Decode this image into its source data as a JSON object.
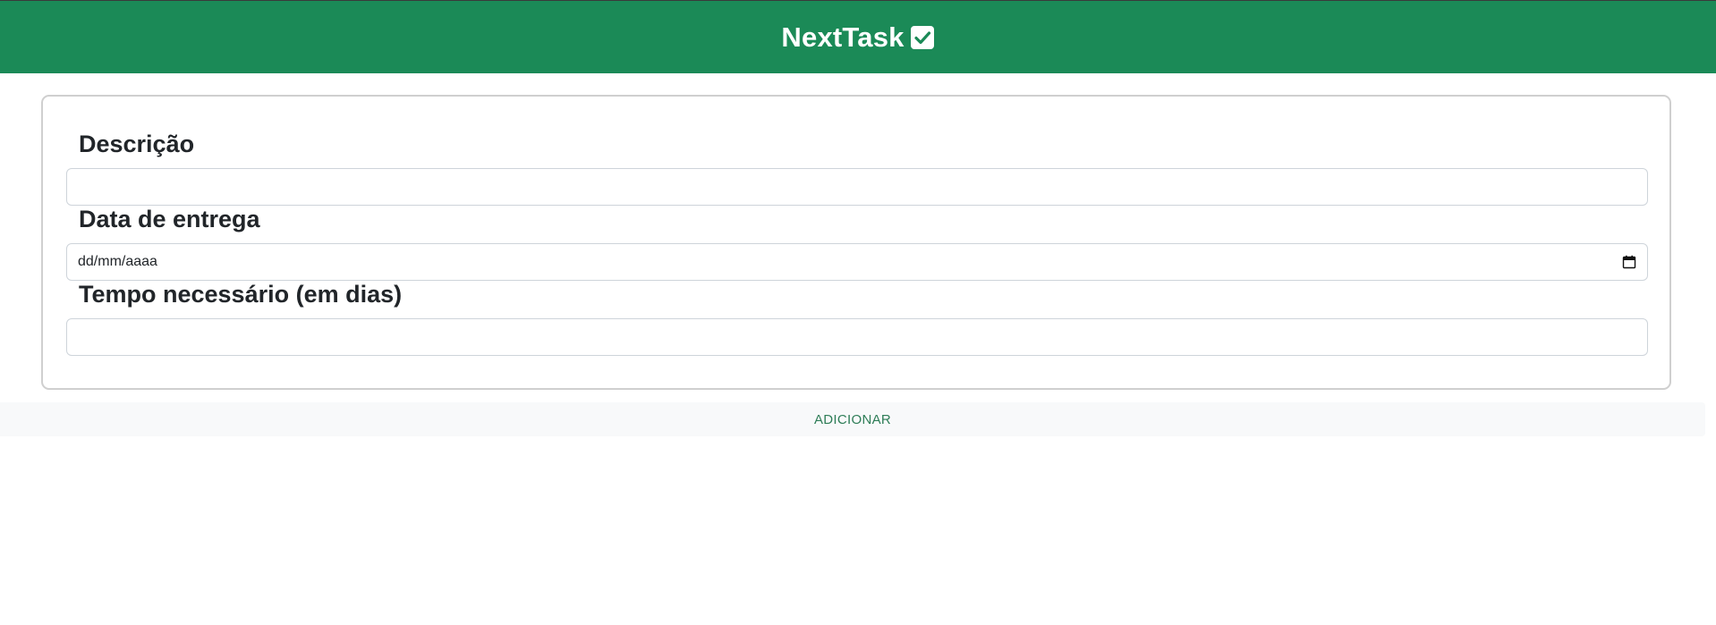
{
  "header": {
    "brand": "NextTask",
    "brand_icon": "check-square-icon",
    "background_color": "#1b8a57"
  },
  "form": {
    "description": {
      "label": "Descrição",
      "value": ""
    },
    "due_date": {
      "label": "Data de entrega",
      "placeholder": "dd/mm/aaaa",
      "icon": "calendar-icon"
    },
    "time_needed": {
      "label": "Tempo necessário (em dias)",
      "value": ""
    }
  },
  "actions": {
    "add_label": "ADICIONAR",
    "add_color": "#2e7d57"
  }
}
